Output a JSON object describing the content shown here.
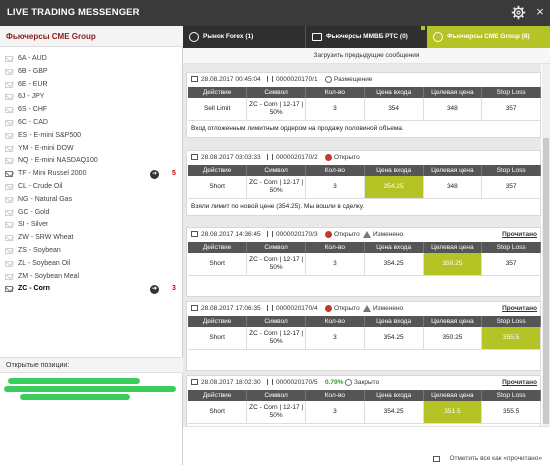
{
  "window": {
    "title": "LIVE TRADING MESSENGER",
    "close_glyph": "×"
  },
  "sidebar": {
    "title": "Фьючерсы CME Group",
    "items": [
      {
        "label": "6A - AUD"
      },
      {
        "label": "6B - GBP"
      },
      {
        "label": "6E - EUR"
      },
      {
        "label": "6J - JPY"
      },
      {
        "label": "6S - CHF"
      },
      {
        "label": "6C - CAD"
      },
      {
        "label": "ES - E-mini S&P500"
      },
      {
        "label": "YM - E-mini DOW"
      },
      {
        "label": "NQ - E-mini NASDAQ100"
      },
      {
        "label": "TF - Mini Russel 2000",
        "count": "5"
      },
      {
        "label": "CL - Crude Oil"
      },
      {
        "label": "NG - Natural Gas"
      },
      {
        "label": "GC - Gold"
      },
      {
        "label": "SI - Silver"
      },
      {
        "label": "ZW - SRW Wheat"
      },
      {
        "label": "ZS - Soybean"
      },
      {
        "label": "ZL - Soybean Oil"
      },
      {
        "label": "ZM - Soybean Meal"
      },
      {
        "label": "ZC - Corn",
        "count": "3"
      }
    ],
    "positions_label": "Открытые позиции:"
  },
  "tabs": [
    {
      "label": "Рынок Forex (1)",
      "icon": "stopwatch-icon"
    },
    {
      "label": "Фьючерсы ММВБ РТС (0)",
      "icon": "briefcase-icon"
    },
    {
      "label": "Фьючерсы CME Group (8)",
      "icon": "dollar-icon"
    }
  ],
  "load_more": "Загрузить предыдущие сообщения",
  "columns": [
    "Действие",
    "Символ",
    "Кол-во",
    "Цена входа",
    "Целевая цена",
    "Stop Loss"
  ],
  "cards": [
    {
      "date": "28.08.2017 00:45:04",
      "id": "0000020170/1",
      "status": "Размещение",
      "status_type": "pending",
      "row": [
        "Sell Limit",
        "ZC - Corn | 12-17 | 50%",
        "3",
        "354",
        "348",
        "357"
      ],
      "note": "Вход отложенным лимитным ордером на продажу половиной объема."
    },
    {
      "date": "28.08.2017 03:03:33",
      "id": "0000020170/2",
      "status": "Открыто",
      "status_type": "open",
      "row": [
        "Short",
        "ZC - Corn | 12-17 | 50%",
        "3",
        "354.25",
        "348",
        "357"
      ],
      "highlight": 3,
      "note": "Взяли лимит по новой цене (354.25). Мы вошли в сделку."
    },
    {
      "date": "28.08.2017 14:36:45",
      "id": "0000020170/3",
      "status": "Открыто",
      "status_type": "open",
      "status2": "Изменено",
      "read": "Прочитано",
      "row": [
        "Short",
        "ZC - Corn | 12-17 | 50%",
        "3",
        "354.25",
        "350.25",
        "357"
      ],
      "highlight": 4
    },
    {
      "date": "28.08.2017 17:06:35",
      "id": "0000020170/4",
      "status": "Открыто",
      "status_type": "open",
      "status2": "Изменено",
      "read": "Прочитано",
      "row": [
        "Short",
        "ZC - Corn | 12-17 | 50%",
        "3",
        "354.25",
        "350.25",
        "355.5"
      ],
      "highlight": 5
    },
    {
      "date": "28.08.2017 18:02:30",
      "id": "0000020170/5",
      "profit": "0.79%",
      "status": "Закрыто",
      "status_type": "closed",
      "read": "Прочитано",
      "row": [
        "Short",
        "ZC - Corn | 12-17 | 50%",
        "3",
        "354.25",
        "351.5",
        "355.5"
      ],
      "highlight": 4,
      "note": "закрываем сделку с профитом."
    }
  ],
  "footer": {
    "mark_read": "Отметить все как «прочитано»"
  }
}
